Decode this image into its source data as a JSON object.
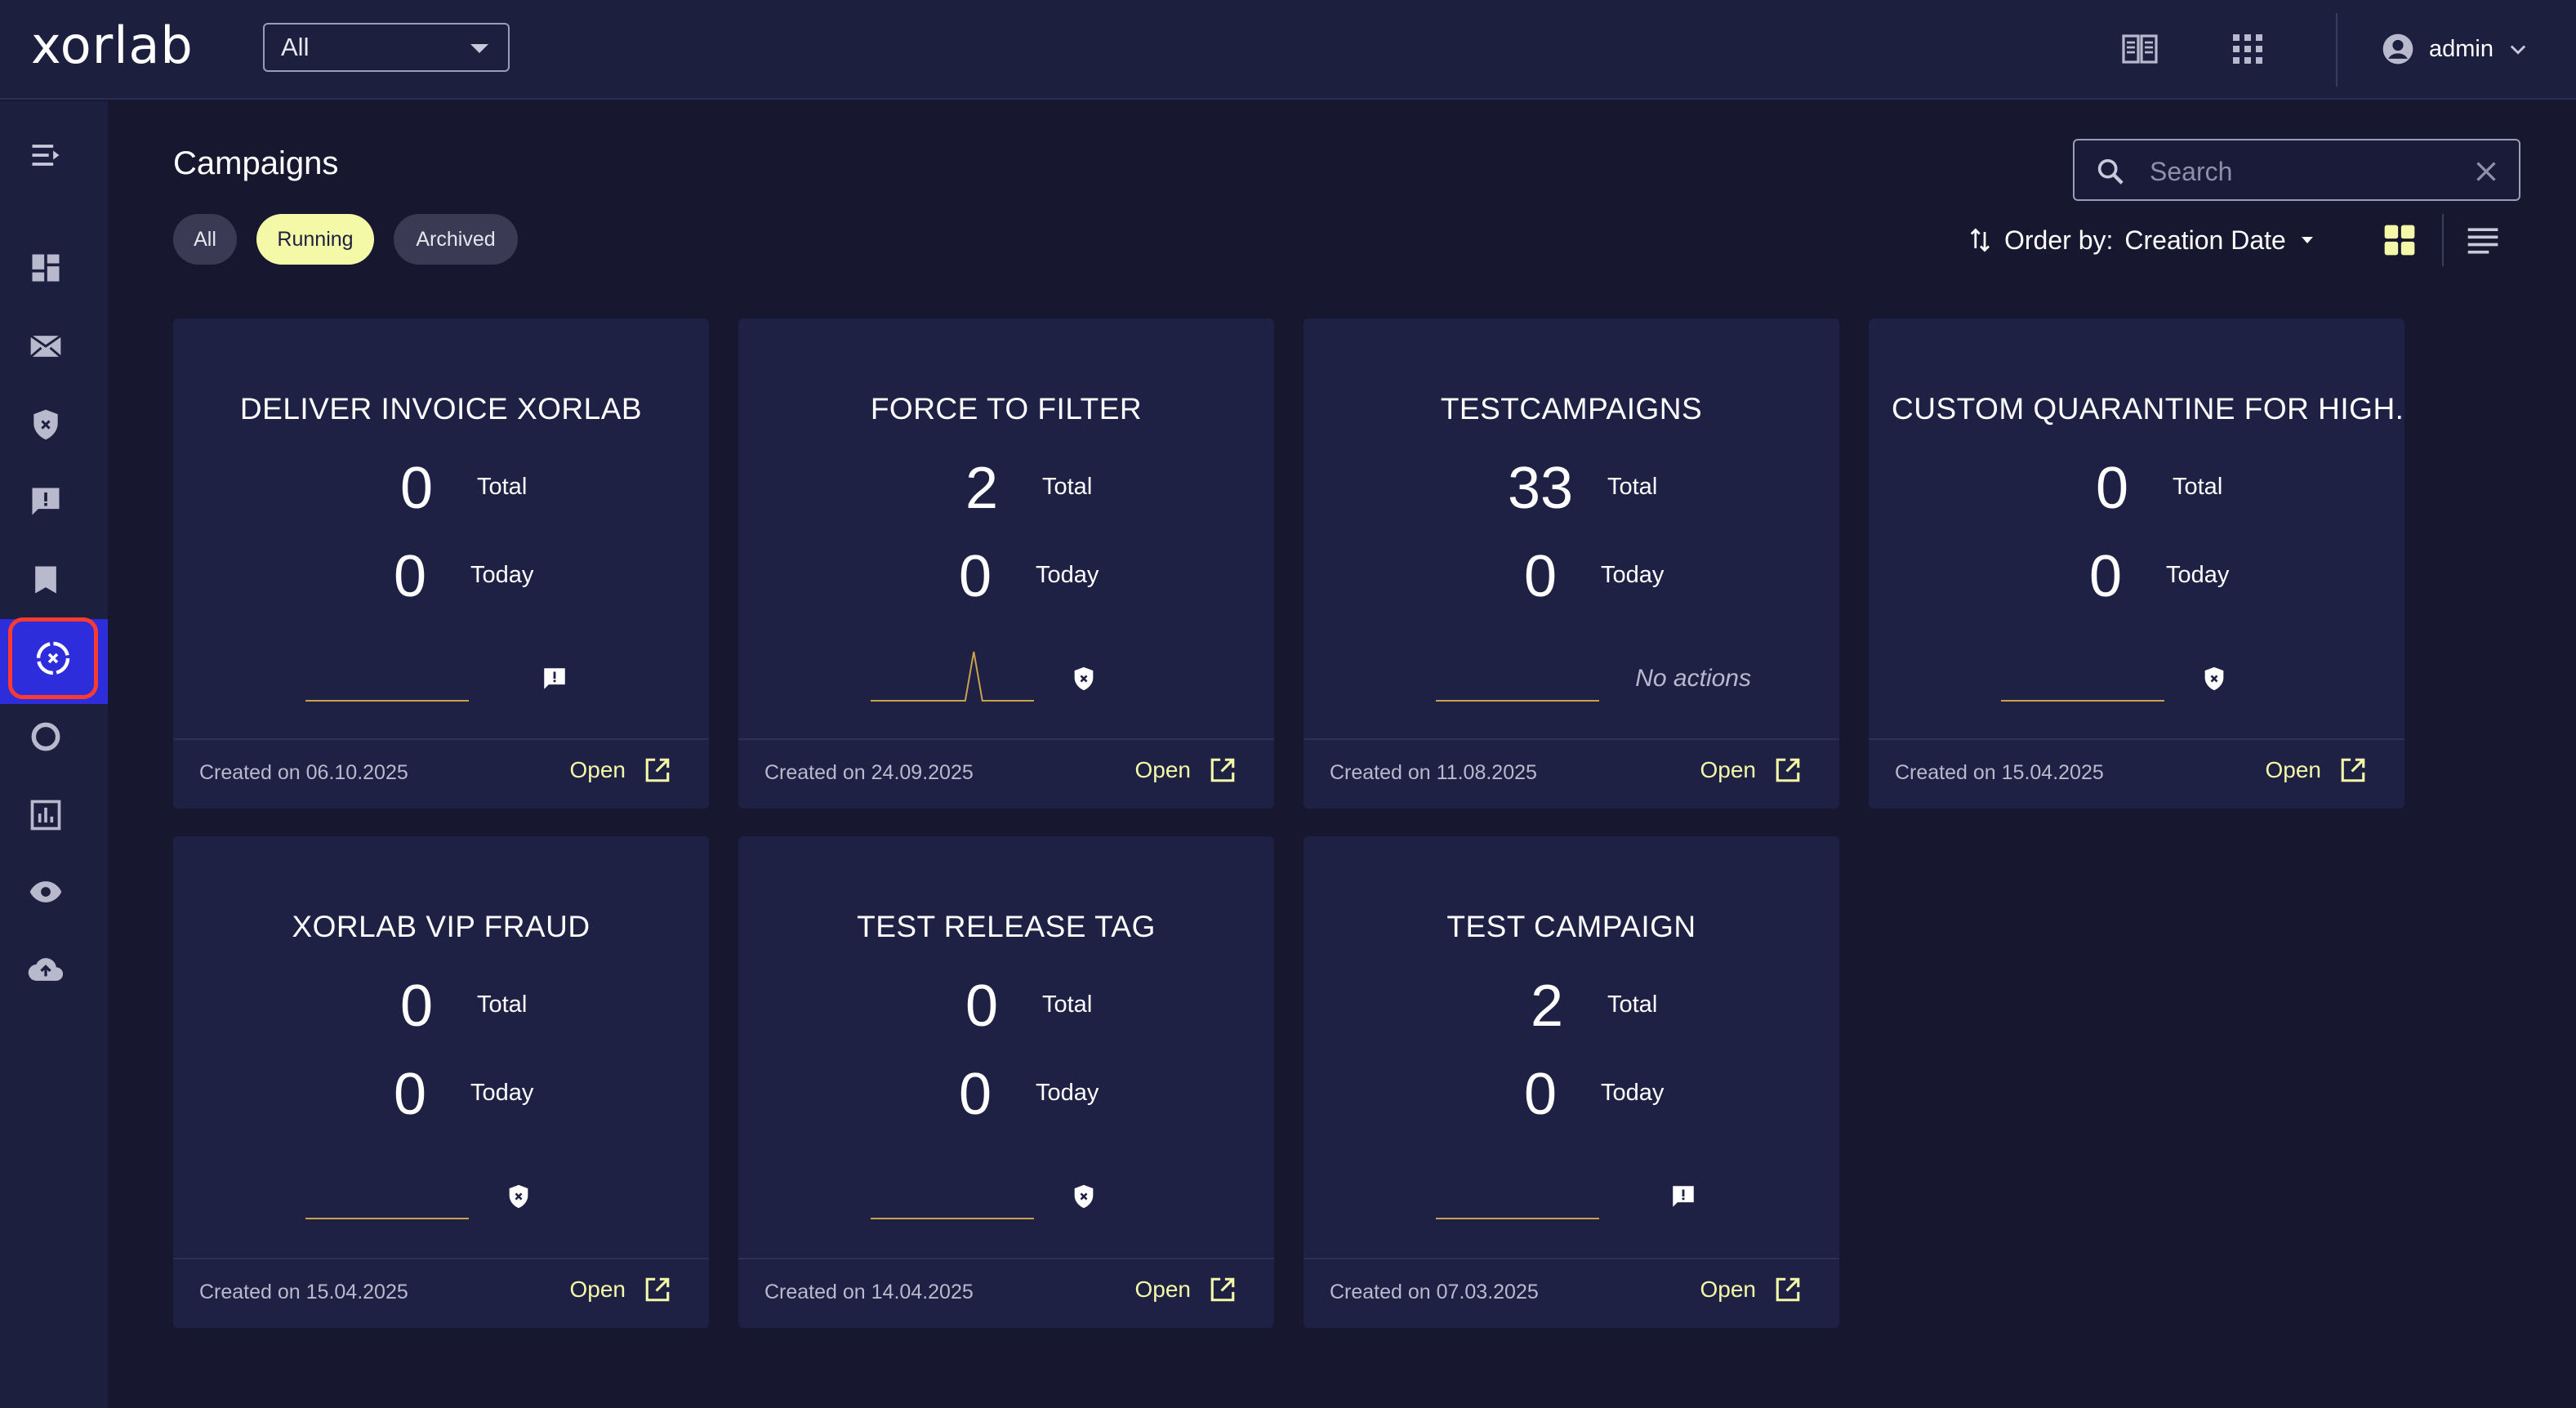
{
  "app": {
    "logo_text": "xorlab",
    "tenant_select": "All",
    "user_name": "admin"
  },
  "colors": {
    "background": "#171730",
    "panel": "#1d1f3f",
    "card": "#1f2144",
    "accent": "#f4f9a8",
    "active_nav": "#2d2ddb",
    "highlight_outline": "#ff3b30",
    "spark_line": "#c9a24a"
  },
  "topbar_icons": [
    "docs-icon",
    "apps-grid-icon",
    "account-circle-icon",
    "chevron-down-icon"
  ],
  "sidebar": {
    "items": [
      {
        "name": "collapse-menu-icon"
      },
      {
        "name": "dashboard-icon"
      },
      {
        "name": "mail-icon"
      },
      {
        "name": "shield-icon"
      },
      {
        "name": "report-icon"
      },
      {
        "name": "bookmark-icon"
      },
      {
        "name": "campaigns-icon",
        "active": true
      },
      {
        "name": "ring-icon"
      },
      {
        "name": "analytics-icon"
      },
      {
        "name": "eye-icon"
      },
      {
        "name": "cloud-upload-icon"
      }
    ]
  },
  "header": {
    "title": "Campaigns",
    "filters": [
      {
        "label": "All",
        "active": false
      },
      {
        "label": "Running",
        "active": true
      },
      {
        "label": "Archived",
        "active": false
      }
    ],
    "search_placeholder": "Search",
    "order_by_label": "Order by:",
    "order_by_value": "Creation Date",
    "view_mode": "grid"
  },
  "card_labels": {
    "total": "Total",
    "today": "Today",
    "open": "Open"
  },
  "campaigns": [
    {
      "title": "DELIVER INVOICE XORLAB",
      "total": "0",
      "today": "0",
      "action_icon": "report-icon",
      "spark": [
        0,
        0,
        0,
        0,
        0,
        0,
        0,
        0,
        0,
        0,
        0,
        0,
        0,
        0,
        0,
        0,
        0,
        0,
        0,
        0
      ],
      "created": "Created on 06.10.2025"
    },
    {
      "title": "FORCE TO FILTER",
      "total": "2",
      "today": "0",
      "action_icon": "shield-icon",
      "spark": [
        0,
        0,
        0,
        0,
        0,
        0,
        0,
        0,
        0,
        0,
        0,
        0,
        1,
        0,
        0,
        0,
        0,
        0,
        0,
        0
      ],
      "created": "Created on 24.09.2025"
    },
    {
      "title": "TESTCAMPAIGNS",
      "total": "33",
      "today": "0",
      "action_icon": null,
      "no_actions": "No actions",
      "spark": [
        0,
        0,
        0,
        0,
        0,
        0,
        0,
        0,
        0,
        0,
        0,
        0,
        0,
        0,
        0,
        0,
        0,
        0,
        0,
        0
      ],
      "created": "Created on 11.08.2025"
    },
    {
      "title": "CUSTOM QUARANTINE FOR HIGH..",
      "total": "0",
      "today": "0",
      "action_icon": "shield-icon",
      "spark": [
        0,
        0,
        0,
        0,
        0,
        0,
        0,
        0,
        0,
        0,
        0,
        0,
        0,
        0,
        0,
        0,
        0,
        0,
        0,
        0
      ],
      "created": "Created on 15.04.2025"
    },
    {
      "title": "XORLAB VIP FRAUD",
      "total": "0",
      "today": "0",
      "action_icon": "shield-icon",
      "spark": [
        0,
        0,
        0,
        0,
        0,
        0,
        0,
        0,
        0,
        0,
        0,
        0,
        0,
        0,
        0,
        0,
        0,
        0,
        0,
        0
      ],
      "created": "Created on 15.04.2025"
    },
    {
      "title": "TEST RELEASE TAG",
      "total": "0",
      "today": "0",
      "action_icon": "shield-icon",
      "spark": [
        0,
        0,
        0,
        0,
        0,
        0,
        0,
        0,
        0,
        0,
        0,
        0,
        0,
        0,
        0,
        0,
        0,
        0,
        0,
        0
      ],
      "created": "Created on 14.04.2025"
    },
    {
      "title": "TEST CAMPAIGN",
      "total": "2",
      "today": "0",
      "action_icon": "report-icon",
      "spark": [
        0,
        0,
        0,
        0,
        0,
        0,
        0,
        0,
        0,
        0,
        0,
        0,
        0,
        0,
        0,
        0,
        0,
        0,
        0,
        0
      ],
      "created": "Created on 07.03.2025"
    }
  ]
}
